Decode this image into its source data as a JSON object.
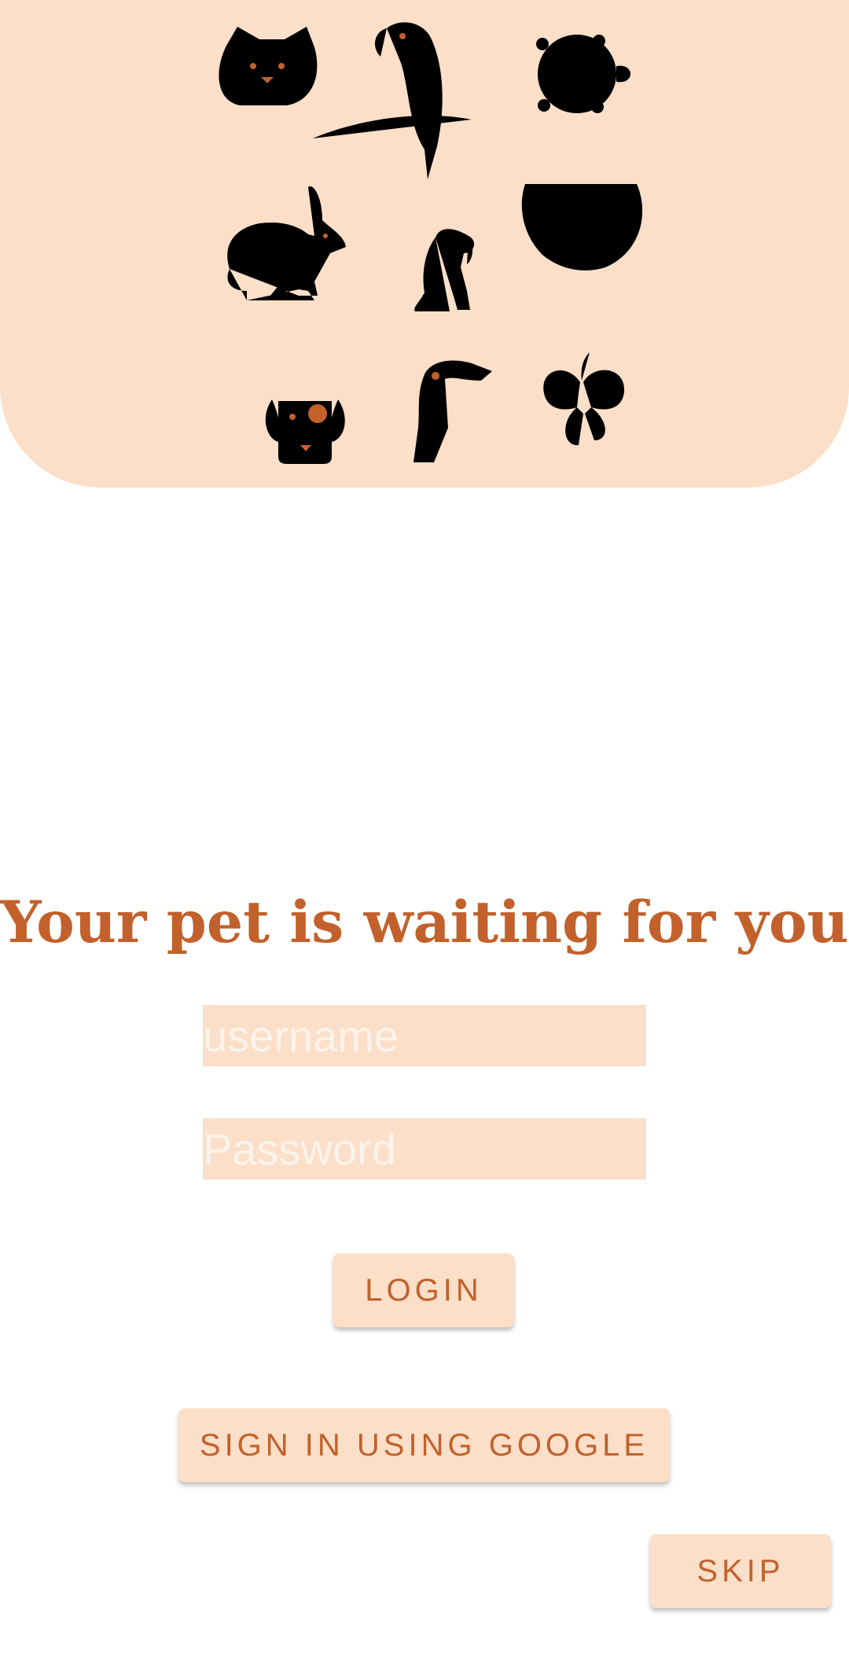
{
  "header": {
    "icons": [
      "cat-icon",
      "parrot-icon",
      "turtle-icon",
      "rabbit-icon",
      "puppy-icon",
      "fishbowl-icon",
      "dog-face-icon",
      "toucan-icon",
      "butterfly-icon"
    ],
    "background_color": "#FBDFC8",
    "icon_color": "#C2612B"
  },
  "main": {
    "title": "Your pet is waiting for you"
  },
  "form": {
    "username_placeholder": "username",
    "username_value": "",
    "password_placeholder": "Password",
    "password_value": ""
  },
  "actions": {
    "login_label": "LOGIN",
    "google_label": "SIGN IN USING GOOGLE",
    "skip_label": "SKIP"
  },
  "colors": {
    "accent": "#C2612B",
    "surface": "#FBDFC8",
    "placeholder": "#FCF3EC"
  }
}
